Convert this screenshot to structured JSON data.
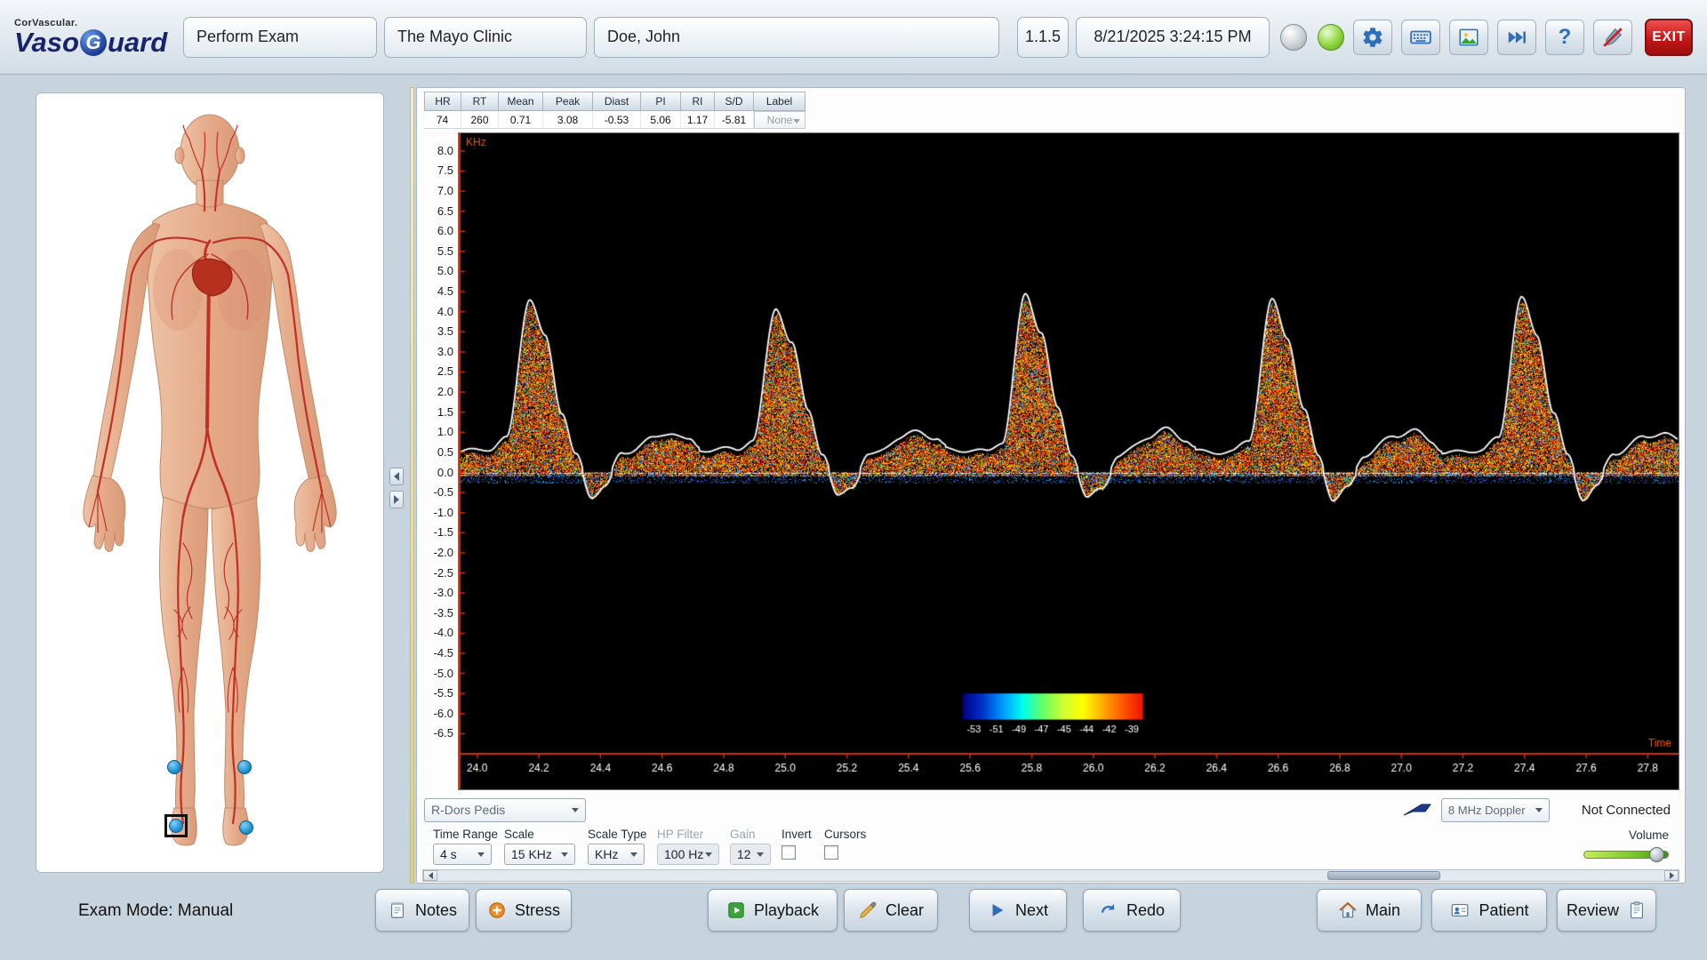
{
  "app": {
    "brand_small": "CorVascular.",
    "brand_prefix": "Vaso",
    "brand_g": "G",
    "brand_suffix": "uard",
    "mode_field": "Perform Exam",
    "clinic_field": "The Mayo Clinic",
    "patient_field": "Doe, John",
    "version": "1.1.5",
    "datetime": "8/21/2025 3:24:15 PM",
    "exit_label": "EXIT"
  },
  "colors": {
    "accent_blue": "#2f6fba",
    "exit_red": "#c41616",
    "led_active_green": "#7ac63e",
    "led_inactive_gray": "#ccd1d6",
    "axis_orange": "#cc3300",
    "marker_blue": "#1787c9"
  },
  "measurements": {
    "headers": [
      "HR",
      "RT",
      "Mean",
      "Peak",
      "Diast",
      "PI",
      "RI",
      "S/D",
      "Label"
    ],
    "values": [
      "74",
      "260",
      "0.71",
      "3.08",
      "-0.53",
      "5.06",
      "1.17",
      "-5.81",
      "None"
    ]
  },
  "chart_data": {
    "type": "heatmap",
    "subtype": "spectral-doppler-waveform",
    "title": "Doppler spectral trace",
    "ylabel": "KHz",
    "xlabel": "Time",
    "xlim": [
      23.94,
      27.9
    ],
    "ylim": [
      -7.0,
      8.35
    ],
    "yticks": [
      "8.0",
      "7.5",
      "7.0",
      "6.5",
      "6.0",
      "5.5",
      "5.0",
      "4.5",
      "4.0",
      "3.5",
      "3.0",
      "2.5",
      "2.0",
      "1.5",
      "1.0",
      "0.5",
      "0.0",
      "-0.5",
      "-1.0",
      "-1.5",
      "-2.0",
      "-2.5",
      "-3.0",
      "-3.5",
      "-4.0",
      "-4.5",
      "-5.0",
      "-5.5",
      "-6.0",
      "-6.5"
    ],
    "xticks": [
      "24.0",
      "24.2",
      "24.4",
      "24.6",
      "24.8",
      "25.0",
      "25.2",
      "25.4",
      "25.6",
      "25.8",
      "26.0",
      "26.2",
      "26.4",
      "26.6",
      "26.8",
      "27.0",
      "27.2",
      "27.4",
      "27.6",
      "27.8"
    ],
    "axis_color": "#cc3300",
    "envelope_color": "#ffffff",
    "grid": false,
    "beats": {
      "times": [
        24.17,
        24.97,
        25.78,
        26.58,
        27.39
      ],
      "peaks": [
        4.25,
        4.05,
        4.35,
        4.15,
        4.25
      ],
      "baseline": 0.45,
      "dip": -0.58,
      "diastolic_bump": 0.95
    },
    "colorbar": {
      "labels": [
        "-53",
        "-51",
        "-49",
        "-47",
        "-45",
        "-44",
        "-42",
        "-39"
      ],
      "stops": [
        "#000080",
        "#0033cc",
        "#0099ff",
        "#00ffee",
        "#66ff66",
        "#ccff33",
        "#ffff00",
        "#ffaa00",
        "#ff5500",
        "#ee1100"
      ]
    }
  },
  "site_select": {
    "value": "R-Dors Pedis"
  },
  "probe": {
    "label": "8 MHz Doppler",
    "status": "Not Connected"
  },
  "controls": {
    "time_range": {
      "label": "Time Range",
      "value": "4 s"
    },
    "scale": {
      "label": "Scale",
      "value": "15 KHz"
    },
    "scale_type": {
      "label": "Scale Type",
      "value": "KHz"
    },
    "hp_filter": {
      "label": "HP Filter",
      "value": "100 Hz",
      "enabled": false
    },
    "gain": {
      "label": "Gain",
      "value": "12",
      "enabled": false
    },
    "invert": {
      "label": "Invert",
      "checked": false
    },
    "cursors": {
      "label": "Cursors",
      "checked": false
    },
    "volume": {
      "label": "Volume",
      "percent": 88
    }
  },
  "body_map": {
    "points": [
      {
        "id": "r-ankle",
        "x": 148,
        "y": 752,
        "selected": false
      },
      {
        "id": "r-foot",
        "x": 150,
        "y": 818,
        "selected": true
      },
      {
        "id": "l-ankle",
        "x": 227,
        "y": 752,
        "selected": false
      },
      {
        "id": "l-foot",
        "x": 229,
        "y": 820,
        "selected": false
      }
    ]
  },
  "toolbar": {
    "exam_mode": "Exam Mode: Manual",
    "buttons": [
      {
        "label": "Notes"
      },
      {
        "label": "Stress"
      },
      {
        "label": "Playback"
      },
      {
        "label": "Clear"
      },
      {
        "label": "Next"
      },
      {
        "label": "Redo"
      },
      {
        "label": "Main"
      },
      {
        "label": "Patient"
      },
      {
        "label": "Review"
      }
    ]
  }
}
